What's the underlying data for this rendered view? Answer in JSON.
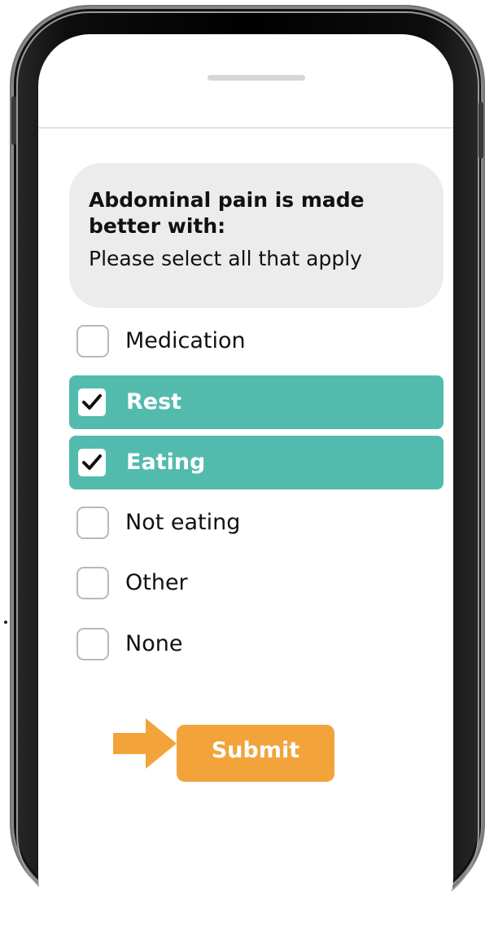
{
  "question": {
    "title": "Abdominal pain is made better with:",
    "subtitle": "Please select all that apply"
  },
  "options": [
    {
      "label": "Medication",
      "selected": false
    },
    {
      "label": "Rest",
      "selected": true
    },
    {
      "label": "Eating",
      "selected": true
    },
    {
      "label": "Not eating",
      "selected": false
    },
    {
      "label": "Other",
      "selected": false
    },
    {
      "label": "None",
      "selected": false
    }
  ],
  "submit": {
    "label": "Submit"
  },
  "colors": {
    "selected_bg": "#52bbad",
    "submit_bg": "#f2a33a",
    "arrow": "#f2a33a",
    "card_bg": "#ececec"
  }
}
